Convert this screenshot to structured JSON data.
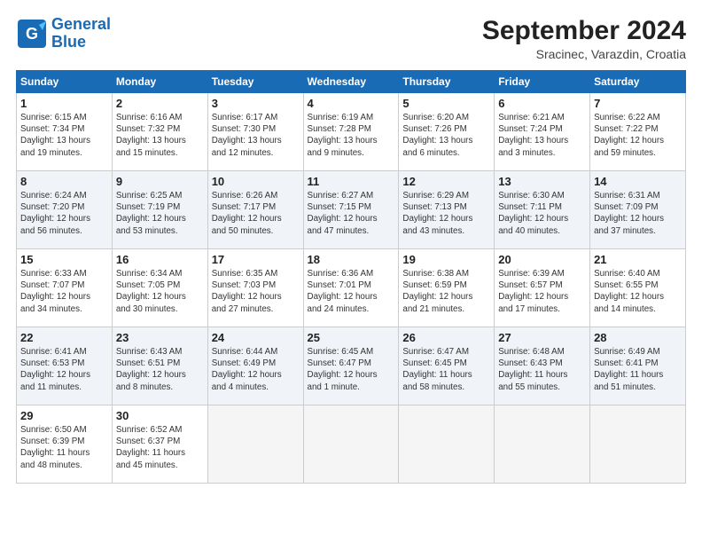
{
  "header": {
    "logo_line1": "General",
    "logo_line2": "Blue",
    "month": "September 2024",
    "location": "Sracinec, Varazdin, Croatia"
  },
  "days_of_week": [
    "Sunday",
    "Monday",
    "Tuesday",
    "Wednesday",
    "Thursday",
    "Friday",
    "Saturday"
  ],
  "weeks": [
    [
      {
        "day": "1",
        "info": "Sunrise: 6:15 AM\nSunset: 7:34 PM\nDaylight: 13 hours\nand 19 minutes."
      },
      {
        "day": "2",
        "info": "Sunrise: 6:16 AM\nSunset: 7:32 PM\nDaylight: 13 hours\nand 15 minutes."
      },
      {
        "day": "3",
        "info": "Sunrise: 6:17 AM\nSunset: 7:30 PM\nDaylight: 13 hours\nand 12 minutes."
      },
      {
        "day": "4",
        "info": "Sunrise: 6:19 AM\nSunset: 7:28 PM\nDaylight: 13 hours\nand 9 minutes."
      },
      {
        "day": "5",
        "info": "Sunrise: 6:20 AM\nSunset: 7:26 PM\nDaylight: 13 hours\nand 6 minutes."
      },
      {
        "day": "6",
        "info": "Sunrise: 6:21 AM\nSunset: 7:24 PM\nDaylight: 13 hours\nand 3 minutes."
      },
      {
        "day": "7",
        "info": "Sunrise: 6:22 AM\nSunset: 7:22 PM\nDaylight: 12 hours\nand 59 minutes."
      }
    ],
    [
      {
        "day": "8",
        "info": "Sunrise: 6:24 AM\nSunset: 7:20 PM\nDaylight: 12 hours\nand 56 minutes."
      },
      {
        "day": "9",
        "info": "Sunrise: 6:25 AM\nSunset: 7:19 PM\nDaylight: 12 hours\nand 53 minutes."
      },
      {
        "day": "10",
        "info": "Sunrise: 6:26 AM\nSunset: 7:17 PM\nDaylight: 12 hours\nand 50 minutes."
      },
      {
        "day": "11",
        "info": "Sunrise: 6:27 AM\nSunset: 7:15 PM\nDaylight: 12 hours\nand 47 minutes."
      },
      {
        "day": "12",
        "info": "Sunrise: 6:29 AM\nSunset: 7:13 PM\nDaylight: 12 hours\nand 43 minutes."
      },
      {
        "day": "13",
        "info": "Sunrise: 6:30 AM\nSunset: 7:11 PM\nDaylight: 12 hours\nand 40 minutes."
      },
      {
        "day": "14",
        "info": "Sunrise: 6:31 AM\nSunset: 7:09 PM\nDaylight: 12 hours\nand 37 minutes."
      }
    ],
    [
      {
        "day": "15",
        "info": "Sunrise: 6:33 AM\nSunset: 7:07 PM\nDaylight: 12 hours\nand 34 minutes."
      },
      {
        "day": "16",
        "info": "Sunrise: 6:34 AM\nSunset: 7:05 PM\nDaylight: 12 hours\nand 30 minutes."
      },
      {
        "day": "17",
        "info": "Sunrise: 6:35 AM\nSunset: 7:03 PM\nDaylight: 12 hours\nand 27 minutes."
      },
      {
        "day": "18",
        "info": "Sunrise: 6:36 AM\nSunset: 7:01 PM\nDaylight: 12 hours\nand 24 minutes."
      },
      {
        "day": "19",
        "info": "Sunrise: 6:38 AM\nSunset: 6:59 PM\nDaylight: 12 hours\nand 21 minutes."
      },
      {
        "day": "20",
        "info": "Sunrise: 6:39 AM\nSunset: 6:57 PM\nDaylight: 12 hours\nand 17 minutes."
      },
      {
        "day": "21",
        "info": "Sunrise: 6:40 AM\nSunset: 6:55 PM\nDaylight: 12 hours\nand 14 minutes."
      }
    ],
    [
      {
        "day": "22",
        "info": "Sunrise: 6:41 AM\nSunset: 6:53 PM\nDaylight: 12 hours\nand 11 minutes."
      },
      {
        "day": "23",
        "info": "Sunrise: 6:43 AM\nSunset: 6:51 PM\nDaylight: 12 hours\nand 8 minutes."
      },
      {
        "day": "24",
        "info": "Sunrise: 6:44 AM\nSunset: 6:49 PM\nDaylight: 12 hours\nand 4 minutes."
      },
      {
        "day": "25",
        "info": "Sunrise: 6:45 AM\nSunset: 6:47 PM\nDaylight: 12 hours\nand 1 minute."
      },
      {
        "day": "26",
        "info": "Sunrise: 6:47 AM\nSunset: 6:45 PM\nDaylight: 11 hours\nand 58 minutes."
      },
      {
        "day": "27",
        "info": "Sunrise: 6:48 AM\nSunset: 6:43 PM\nDaylight: 11 hours\nand 55 minutes."
      },
      {
        "day": "28",
        "info": "Sunrise: 6:49 AM\nSunset: 6:41 PM\nDaylight: 11 hours\nand 51 minutes."
      }
    ],
    [
      {
        "day": "29",
        "info": "Sunrise: 6:50 AM\nSunset: 6:39 PM\nDaylight: 11 hours\nand 48 minutes."
      },
      {
        "day": "30",
        "info": "Sunrise: 6:52 AM\nSunset: 6:37 PM\nDaylight: 11 hours\nand 45 minutes."
      },
      {
        "day": "",
        "info": ""
      },
      {
        "day": "",
        "info": ""
      },
      {
        "day": "",
        "info": ""
      },
      {
        "day": "",
        "info": ""
      },
      {
        "day": "",
        "info": ""
      }
    ]
  ]
}
